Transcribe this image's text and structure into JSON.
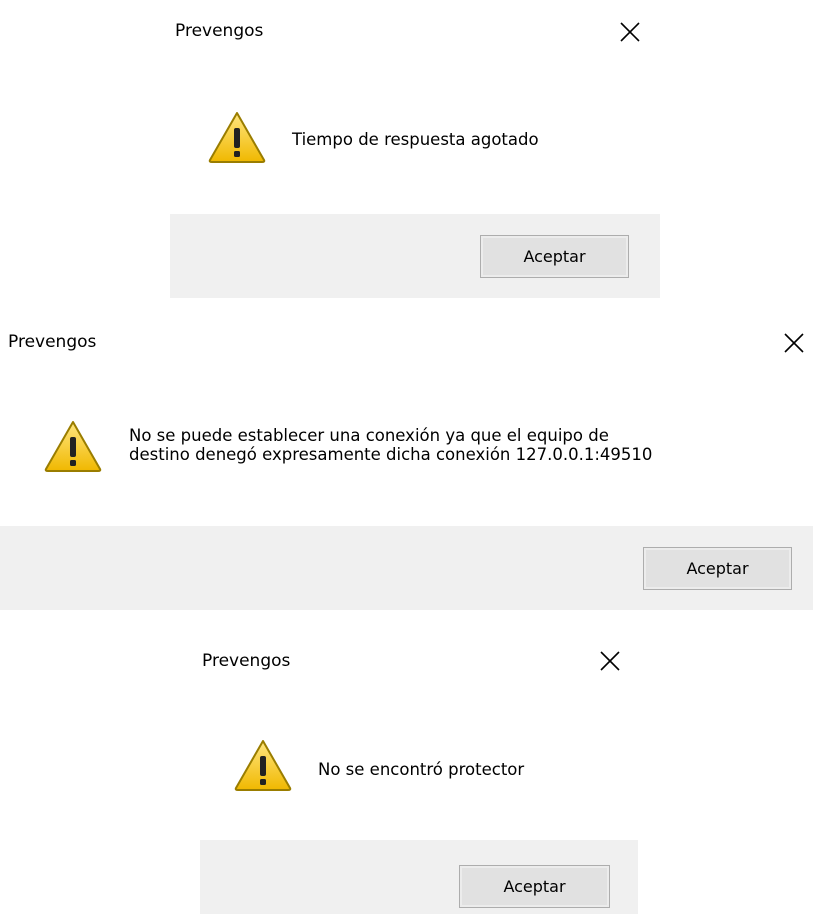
{
  "dialogs": [
    {
      "title": "Prevengos",
      "message_lines": [
        "Tiempo de respuesta agotado"
      ],
      "icon": "warning-icon",
      "button_label": "Aceptar"
    },
    {
      "title": "Prevengos",
      "message_lines": [
        "No se puede establecer una conexión ya que el equipo de",
        "destino denegó expresamente dicha conexión 127.0.0.1:49510"
      ],
      "icon": "warning-icon",
      "button_label": "Aceptar"
    },
    {
      "title": "Prevengos",
      "message_lines": [
        "No se encontró protector"
      ],
      "icon": "warning-icon",
      "button_label": "Aceptar"
    }
  ],
  "colors": {
    "footer_background": "#f0f0f0",
    "button_background": "#e1e1e1",
    "button_border": "#adadad",
    "warning_yellow": "#f5c400",
    "warning_outline": "#9a7d00"
  }
}
